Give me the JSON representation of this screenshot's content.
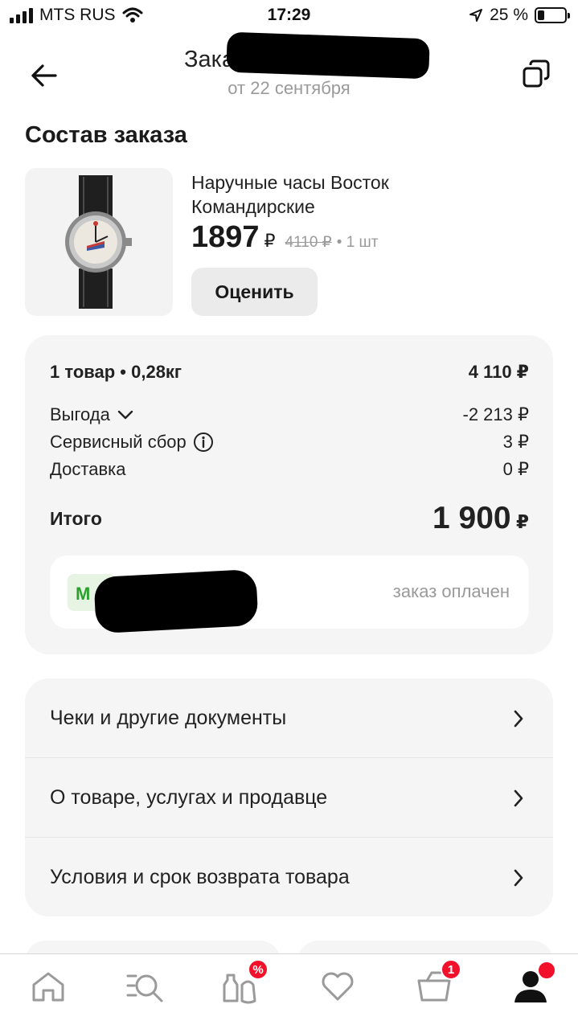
{
  "status_bar": {
    "carrier": "MTS RUS",
    "time": "17:29",
    "battery_percent": "25 %",
    "battery_level": 0.25
  },
  "header": {
    "title": "Заказ",
    "subtitle": "от 22 сентября"
  },
  "section_title": "Состав заказа",
  "product": {
    "name": "Наручные часы Восток Командирские",
    "price": "1897",
    "currency": "₽",
    "old_price": "4110 ₽",
    "quantity": "• 1 шт",
    "rate_label": "Оценить"
  },
  "summary": {
    "items_label": "1 товар • 0,28кг",
    "items_value": "4 110 ₽",
    "benefit_label": "Выгода",
    "benefit_value": "-2 213 ₽",
    "service_label": "Сервисный сбор",
    "service_value": "3 ₽",
    "delivery_label": "Доставка",
    "delivery_value": "0 ₽",
    "total_label": "Итого",
    "total_value": "1 900",
    "total_currency": "₽"
  },
  "payment": {
    "logo_letter": "М",
    "status": "заказ оплачен"
  },
  "links": [
    {
      "label": "Чеки и другие документы"
    },
    {
      "label": "О товаре, услугах и продавце"
    },
    {
      "label": "Условия и срок возврата товара"
    }
  ],
  "tabbar": {
    "items": [
      {
        "icon": "home-icon"
      },
      {
        "icon": "catalog-search-icon"
      },
      {
        "icon": "grocery-icon",
        "badge": "%"
      },
      {
        "icon": "favorites-heart-icon"
      },
      {
        "icon": "cart-icon",
        "badge": "1"
      },
      {
        "icon": "profile-icon"
      }
    ]
  },
  "colors": {
    "badge_red": "#f2102a",
    "card_bg": "#f5f5f5",
    "muted_text": "#9a9a9a",
    "payment_green": "#2aa12d"
  }
}
